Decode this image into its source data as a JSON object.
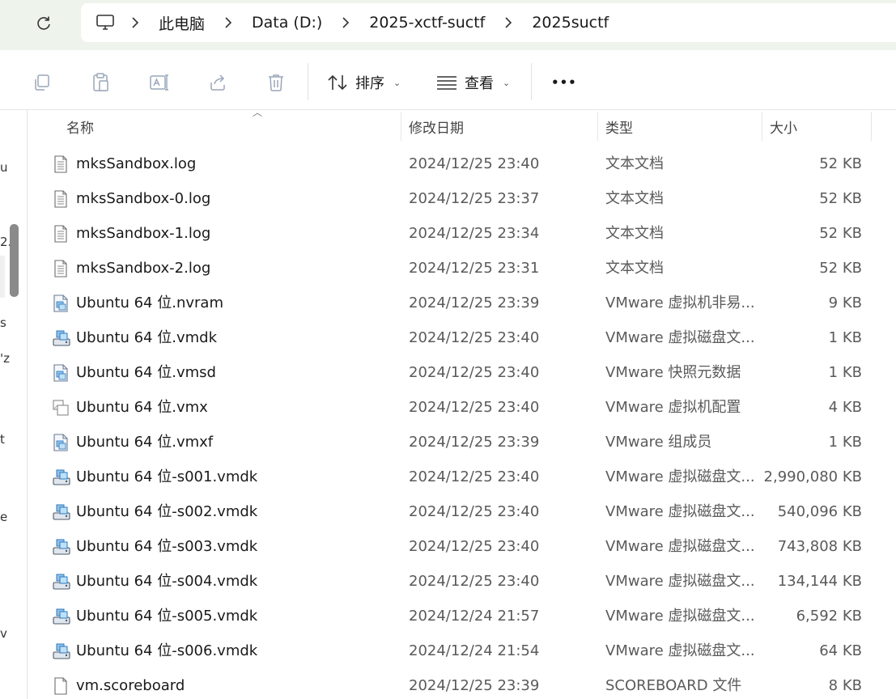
{
  "address": {
    "refresh_icon": "refresh-icon",
    "pc_icon": "monitor-icon",
    "crumbs": [
      "此电脑",
      "Data (D:)",
      "2025-xctf-suctf",
      "2025suctf"
    ]
  },
  "toolbar": {
    "icons": [
      "copy-icon",
      "paste-icon",
      "rename-icon",
      "share-icon",
      "delete-icon"
    ],
    "sort_label": "排序",
    "view_label": "查看",
    "more_label": "•••"
  },
  "columns": {
    "name": "名称",
    "date": "修改日期",
    "type": "类型",
    "size": "大小"
  },
  "left_strip": [
    "u",
    "2.",
    "s",
    "'z",
    "t",
    "e",
    "v"
  ],
  "files": [
    {
      "name": "mksSandbox.log",
      "date": "2024/12/25 23:40",
      "type": "文本文档",
      "size": "52 KB",
      "icon": "text-file-icon"
    },
    {
      "name": "mksSandbox-0.log",
      "date": "2024/12/25 23:37",
      "type": "文本文档",
      "size": "52 KB",
      "icon": "text-file-icon"
    },
    {
      "name": "mksSandbox-1.log",
      "date": "2024/12/25 23:34",
      "type": "文本文档",
      "size": "52 KB",
      "icon": "text-file-icon"
    },
    {
      "name": "mksSandbox-2.log",
      "date": "2024/12/25 23:31",
      "type": "文本文档",
      "size": "52 KB",
      "icon": "text-file-icon"
    },
    {
      "name": "Ubuntu 64 位.nvram",
      "date": "2024/12/25 23:39",
      "type": "VMware 虚拟机非易...",
      "size": "9 KB",
      "icon": "vmware-file-icon"
    },
    {
      "name": "Ubuntu 64 位.vmdk",
      "date": "2024/12/25 23:40",
      "type": "VMware 虚拟磁盘文...",
      "size": "1 KB",
      "icon": "vmware-disk-icon"
    },
    {
      "name": "Ubuntu 64 位.vmsd",
      "date": "2024/12/25 23:40",
      "type": "VMware 快照元数据",
      "size": "1 KB",
      "icon": "vmware-file-icon"
    },
    {
      "name": "Ubuntu 64 位.vmx",
      "date": "2024/12/25 23:40",
      "type": "VMware 虚拟机配置",
      "size": "4 KB",
      "icon": "vmx-file-icon"
    },
    {
      "name": "Ubuntu 64 位.vmxf",
      "date": "2024/12/25 23:39",
      "type": "VMware 组成员",
      "size": "1 KB",
      "icon": "vmware-file-icon"
    },
    {
      "name": "Ubuntu 64 位-s001.vmdk",
      "date": "2024/12/25 23:40",
      "type": "VMware 虚拟磁盘文...",
      "size": "2,990,080 KB",
      "icon": "vmware-disk-icon"
    },
    {
      "name": "Ubuntu 64 位-s002.vmdk",
      "date": "2024/12/25 23:40",
      "type": "VMware 虚拟磁盘文...",
      "size": "540,096 KB",
      "icon": "vmware-disk-icon"
    },
    {
      "name": "Ubuntu 64 位-s003.vmdk",
      "date": "2024/12/25 23:40",
      "type": "VMware 虚拟磁盘文...",
      "size": "743,808 KB",
      "icon": "vmware-disk-icon"
    },
    {
      "name": "Ubuntu 64 位-s004.vmdk",
      "date": "2024/12/25 23:40",
      "type": "VMware 虚拟磁盘文...",
      "size": "134,144 KB",
      "icon": "vmware-disk-icon"
    },
    {
      "name": "Ubuntu 64 位-s005.vmdk",
      "date": "2024/12/24 21:57",
      "type": "VMware 虚拟磁盘文...",
      "size": "6,592 KB",
      "icon": "vmware-disk-icon"
    },
    {
      "name": "Ubuntu 64 位-s006.vmdk",
      "date": "2024/12/24 21:54",
      "type": "VMware 虚拟磁盘文...",
      "size": "64 KB",
      "icon": "vmware-disk-icon"
    },
    {
      "name": "vm.scoreboard",
      "date": "2024/12/25 23:39",
      "type": "SCOREBOARD 文件",
      "size": "8 KB",
      "icon": "blank-file-icon"
    }
  ]
}
